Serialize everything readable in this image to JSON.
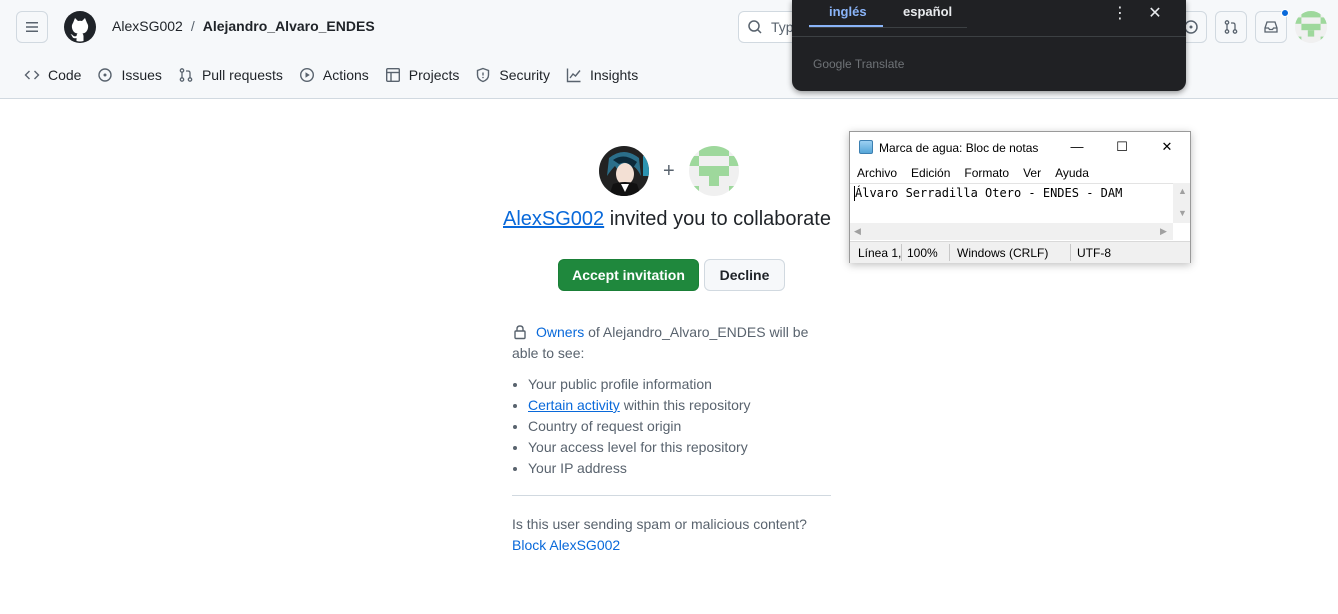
{
  "header": {
    "owner": "AlexSG002",
    "separator": "/",
    "repo": "Alejandro_Alvaro_ENDES",
    "search_placeholder": "Typ"
  },
  "repo_nav": [
    {
      "label": "Code",
      "icon": "code-icon"
    },
    {
      "label": "Issues",
      "icon": "issue-icon"
    },
    {
      "label": "Pull requests",
      "icon": "pull-request-icon"
    },
    {
      "label": "Actions",
      "icon": "play-icon"
    },
    {
      "label": "Projects",
      "icon": "table-icon"
    },
    {
      "label": "Security",
      "icon": "shield-icon"
    },
    {
      "label": "Insights",
      "icon": "graph-icon"
    }
  ],
  "invite": {
    "inviter": "AlexSG002",
    "title_rest": " invited you to collaborate",
    "plus": "+",
    "accept_label": "Accept invitation",
    "decline_label": "Decline",
    "owners_link": "Owners",
    "owners_text": " of Alejandro_Alvaro_ENDES will be able to see:",
    "visible_items": [
      {
        "text": "Your public profile information"
      },
      {
        "link": "Certain activity",
        "text": " within this repository"
      },
      {
        "text": "Country of request origin"
      },
      {
        "text": "Your access level for this repository"
      },
      {
        "text": "Your IP address"
      }
    ],
    "spam_question": "Is this user sending spam or malicious content?",
    "block_label": "Block AlexSG002"
  },
  "translate_popup": {
    "tab_active": "inglés",
    "tab_inactive": "español",
    "brand": "Google Translate",
    "accent": "#8ab4f8"
  },
  "notepad": {
    "title": "Marca de agua: Bloc de notas",
    "menu": [
      "Archivo",
      "Edición",
      "Formato",
      "Ver",
      "Ayuda"
    ],
    "content": "Álvaro Serradilla Otero - ENDES - DAM",
    "status": {
      "position": "Línea 1,",
      "zoom": "100%",
      "line_endings": "Windows (CRLF)",
      "encoding": "UTF-8"
    }
  },
  "colors": {
    "accept_green": "#1f883d",
    "link_blue": "#0969da",
    "header_bg": "#f6f8fa"
  }
}
